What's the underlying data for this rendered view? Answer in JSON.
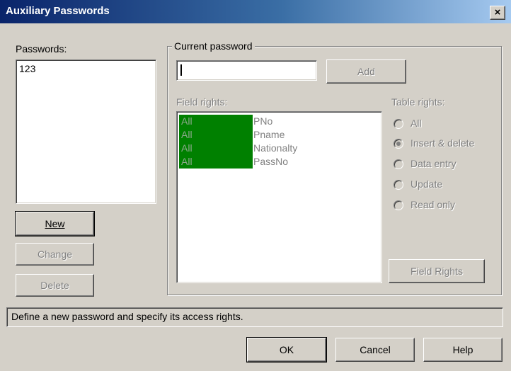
{
  "window": {
    "title": "Auxiliary Passwords",
    "close_label": "×"
  },
  "passwords": {
    "label": "Passwords:",
    "items": [
      "123"
    ]
  },
  "buttons": {
    "new_label": "New",
    "change_label": "Change",
    "delete_label": "Delete",
    "add_label": "Add",
    "field_rights_label": "Field Rights",
    "ok_label": "OK",
    "cancel_label": "Cancel",
    "help_label": "Help"
  },
  "current_password": {
    "group_label": "Current password",
    "input_value": ""
  },
  "field_rights": {
    "label": "Field rights:",
    "rows": [
      {
        "rights": "All",
        "field": "PNo"
      },
      {
        "rights": "All",
        "field": "Pname"
      },
      {
        "rights": "All",
        "field": "Nationalty"
      },
      {
        "rights": "All",
        "field": "PassNo"
      }
    ],
    "highlight_color": "#008000"
  },
  "table_rights": {
    "label": "Table rights:",
    "options": [
      {
        "label": "All",
        "checked": false
      },
      {
        "label": "Insert & delete",
        "checked": true
      },
      {
        "label": "Data entry",
        "checked": false
      },
      {
        "label": "Update",
        "checked": false
      },
      {
        "label": "Read only",
        "checked": false
      }
    ]
  },
  "status": {
    "text": "Define a new password and specify its access rights."
  },
  "colors": {
    "dialog_bg": "#d4d0c8",
    "title_start": "#0a246a",
    "title_end": "#a6caf0",
    "disabled_text": "#808080"
  }
}
